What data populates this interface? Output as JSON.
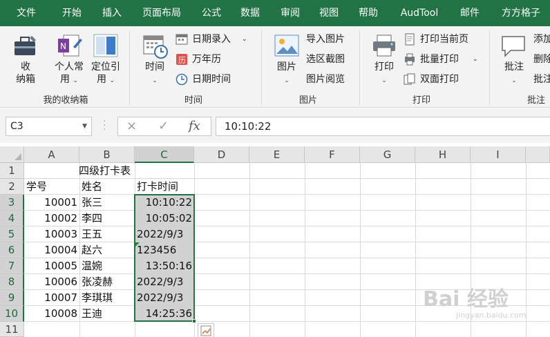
{
  "ribbon_tabs": [
    "文件",
    "开始",
    "插入",
    "页面布局",
    "公式",
    "数据",
    "审阅",
    "视图",
    "帮助",
    "AudTool",
    "邮件",
    "方方格子"
  ],
  "ribbon": {
    "group1": {
      "label": "我的收纳箱",
      "btn1_line1": "收",
      "btn1_line2": "纳箱",
      "btn2_line1": "个人常",
      "btn2_line2": "用",
      "btn3_line1": "定位引",
      "btn3_line2": "用"
    },
    "group2": {
      "label": "时间",
      "big_btn": "时间",
      "date_entry": "日期录入",
      "calendar": "万年历",
      "datetime": "日期时间"
    },
    "group3": {
      "label": "图片",
      "big_btn": "图片",
      "import": "导入图片",
      "screenshot": "选区截图",
      "viewer": "图片阅览"
    },
    "group4": {
      "label": "打印",
      "big_btn": "打印",
      "print_current": "打印当前页",
      "batch_print": "批量打印",
      "duplex_print": "双面打印"
    },
    "group5": {
      "label": "批注",
      "big_btn": "批注",
      "add": "添加",
      "delete": "删除",
      "annot": "批注"
    }
  },
  "formula_bar": {
    "name_box": "C3",
    "cancel_icon": "×",
    "confirm_icon": "✓",
    "fx_label": "fx",
    "formula_value": "10:10:22"
  },
  "columns": [
    "A",
    "B",
    "C",
    "D",
    "E",
    "F",
    "G",
    "H",
    "I"
  ],
  "rows": [
    "1",
    "2",
    "3",
    "4",
    "5",
    "6",
    "7",
    "8",
    "9",
    "10",
    "11"
  ],
  "sheet": {
    "title": "四级打卡表",
    "headers": {
      "a": "学号",
      "b": "姓名",
      "c": "打卡时间"
    },
    "records": [
      {
        "id": "10001",
        "name": "张三",
        "time": "10:10:22"
      },
      {
        "id": "10002",
        "name": "李四",
        "time": "10:05:02"
      },
      {
        "id": "10003",
        "name": "王五",
        "time": "2022/9/3"
      },
      {
        "id": "10004",
        "name": "赵六",
        "time": "123456"
      },
      {
        "id": "10005",
        "name": "温婉",
        "time": "13:50:16"
      },
      {
        "id": "10006",
        "name": "张凌赫",
        "time": "2022/9/3"
      },
      {
        "id": "10007",
        "name": "李琪琪",
        "time": "2022/9/3"
      },
      {
        "id": "10008",
        "name": "王迪",
        "time": "14:25:36"
      }
    ]
  },
  "watermark": {
    "main": "Bai 经验",
    "sub": "jingyan.baidu.com"
  },
  "colors": {
    "accent": "#217346",
    "selection_fill": "#d2d2d2"
  }
}
